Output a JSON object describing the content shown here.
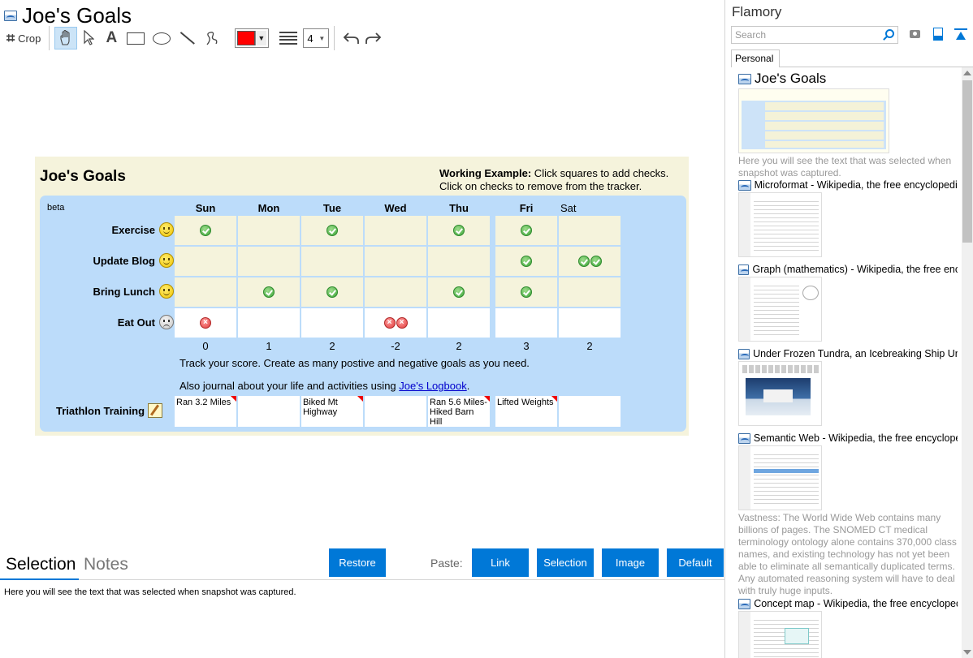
{
  "document": {
    "title": "Joe's Goals"
  },
  "toolbar": {
    "crop_label": "Crop",
    "text_tool_label": "A",
    "color": "#ff0000",
    "line_width": "4",
    "icons": [
      "crop-icon",
      "hand-icon",
      "pointer-icon",
      "text-icon",
      "rectangle-icon",
      "ellipse-icon",
      "line-icon",
      "freehand-icon",
      "color-picker",
      "line-width-icon",
      "undo-icon",
      "redo-icon"
    ]
  },
  "snapshot": {
    "title": "Joe's Goals",
    "example_bold": "Working Example:",
    "example_text": " Click squares to add checks. Click on checks to remove from the tracker.",
    "beta": "beta",
    "days": [
      "Sun",
      "Mon",
      "Tue",
      "Wed",
      "Thu",
      "Fri",
      "Sat"
    ],
    "goals": [
      {
        "name": "Exercise",
        "type": "positive",
        "marks": [
          1,
          0,
          1,
          0,
          1,
          1,
          0
        ]
      },
      {
        "name": "Update Blog",
        "type": "positive",
        "marks": [
          0,
          0,
          0,
          0,
          0,
          1,
          2
        ]
      },
      {
        "name": "Bring Lunch",
        "type": "positive",
        "marks": [
          0,
          1,
          1,
          0,
          1,
          1,
          0
        ]
      },
      {
        "name": "Eat Out",
        "type": "negative",
        "marks": [
          1,
          0,
          0,
          2,
          0,
          0,
          0
        ]
      }
    ],
    "scores": [
      "0",
      "1",
      "2",
      "-2",
      "2",
      "3",
      "2"
    ],
    "track_text": "Track your score. Create as many postive and negative goals as you need.",
    "journal_text": "Also journal about your life and activities using ",
    "journal_link": "Joe's Logbook",
    "journal_end": ".",
    "journal_goal": "Triathlon Training",
    "journal_entries": [
      "Ran 3.2 Miles",
      "",
      "Biked Mt Highway",
      "",
      "Ran 5.6 Miles-Hiked Barn Hill",
      "Lifted Weights",
      ""
    ]
  },
  "bottom": {
    "tab_selection": "Selection",
    "tab_notes": "Notes",
    "restore": "Restore",
    "paste_label": "Paste:",
    "paste_buttons": [
      "Link",
      "Selection",
      "Image",
      "Default"
    ],
    "selection_text": "Here you will see the text that was selected when snapshot was captured."
  },
  "sidebar": {
    "app_name": "Flamory",
    "search_placeholder": "Search",
    "tab_personal": "Personal",
    "items": [
      {
        "title": "Joe's Goals",
        "desc": "Here you will see the text that was selected when snapshot was captured."
      },
      {
        "title": "Microformat - Wikipedia, the free encyclopedia",
        "desc": ""
      },
      {
        "title": "Graph (mathematics) - Wikipedia, the free encyclopedia",
        "desc": ""
      },
      {
        "title": "Under Frozen Tundra, an Icebreaking Ship Uncovers",
        "desc": ""
      },
      {
        "title": "Semantic Web - Wikipedia, the free encyclopedia",
        "desc": "Vastness: The World Wide Web contains many billions of pages. The SNOMED CT medical terminology ontology alone contains 370,000 class names, and existing technology has not yet been able to eliminate all semantically duplicated terms. Any automated reasoning system will have to deal with truly huge inputs."
      },
      {
        "title": "Concept map - Wikipedia, the free encyclopedia",
        "desc": ""
      }
    ]
  }
}
